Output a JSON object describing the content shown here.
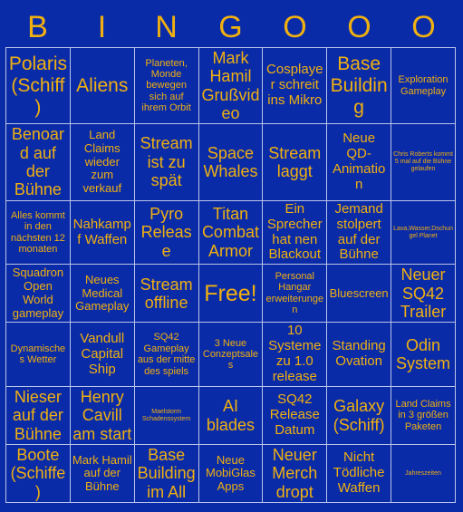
{
  "card": {
    "title_letters": [
      "B",
      "I",
      "N",
      "G",
      "O",
      "O",
      "O"
    ],
    "accent_color": "#f0b010",
    "background_color": "#0a2ba8",
    "grid_line_color": "#b9c4e8",
    "columns": 7,
    "rows": 7,
    "free_label": "Free!",
    "cells": [
      [
        "Polaris (Schiff)",
        "Aliens",
        "Planeten, Monde bewegen sich auf ihrem Orbit",
        "Mark Hamil Grußvideo",
        "Cosplayer schreit ins Mikro",
        "Base Building",
        "Exploration Gameplay"
      ],
      [
        "Benoard auf der Bühne",
        "Land Claims wieder zum verkauf",
        "Stream ist zu spät",
        "Space Whales",
        "Stream laggt",
        "Neue QD-Animation",
        "Chris Roberts kommt 5 mal auf die Bühne gelaufen"
      ],
      [
        "Alles kommt in den nächsten 12 monaten",
        "Nahkampf Waffen",
        "Pyro Release",
        "Titan Combat Armor",
        "Ein Sprecher hat nen Blackout",
        "Jemand stolpert auf der Bühne",
        "Lava,Wasser,Dschungel Planet"
      ],
      [
        "Squadron Open World gameplay",
        "Neues Medical Gameplay",
        "Stream offline",
        "Free!",
        "Personal Hangar erweiterungen",
        "Bluescreen",
        "Neuer SQ42 Trailer"
      ],
      [
        "Dynamisches Wetter",
        "Vandull Capital Ship",
        "SQ42 Gameplay aus der mitte des spiels",
        "3 Neue Conzeptsales",
        "10 Systeme zu 1.0 release",
        "Standing Ovation",
        "Odin System"
      ],
      [
        "Nieser auf der Bühne",
        "Henry Cavill am start",
        "Maelstorm Schadenssystem",
        "AI blades",
        "SQ42 Release Datum",
        "Galaxy (Schiff)",
        "Land Claims in 3 größen Paketen"
      ],
      [
        "Boote (Schiffe)",
        "Mark Hamil auf der Bühne",
        "Base Building im All",
        "Neue MobiGlas Apps",
        "Neuer Merch dropt",
        "Nicht Tödliche Waffen",
        "Jahreszeiten"
      ]
    ],
    "cell_sizes": [
      [
        "s-xl",
        "s-xl",
        "s-xs",
        "s-lg",
        "s-md",
        "s-xl",
        "s-xs"
      ],
      [
        "s-lg",
        "s-sm",
        "s-lg",
        "s-lg",
        "s-lg",
        "s-md",
        "s-xxs"
      ],
      [
        "s-xs",
        "s-md",
        "s-lg",
        "s-lg",
        "s-md",
        "s-md",
        "s-xxs"
      ],
      [
        "s-sm",
        "s-sm",
        "s-lg",
        "free",
        "s-xs",
        "s-sm",
        "s-lg"
      ],
      [
        "s-xs",
        "s-md",
        "s-xs",
        "s-xs",
        "s-md",
        "s-md",
        "s-lg"
      ],
      [
        "s-lg",
        "s-lg",
        "s-xxs",
        "s-lg",
        "s-md",
        "s-lg",
        "s-xs"
      ],
      [
        "s-lg",
        "s-sm",
        "s-lg",
        "s-sm",
        "s-lg",
        "s-md",
        "s-xxs"
      ]
    ]
  }
}
